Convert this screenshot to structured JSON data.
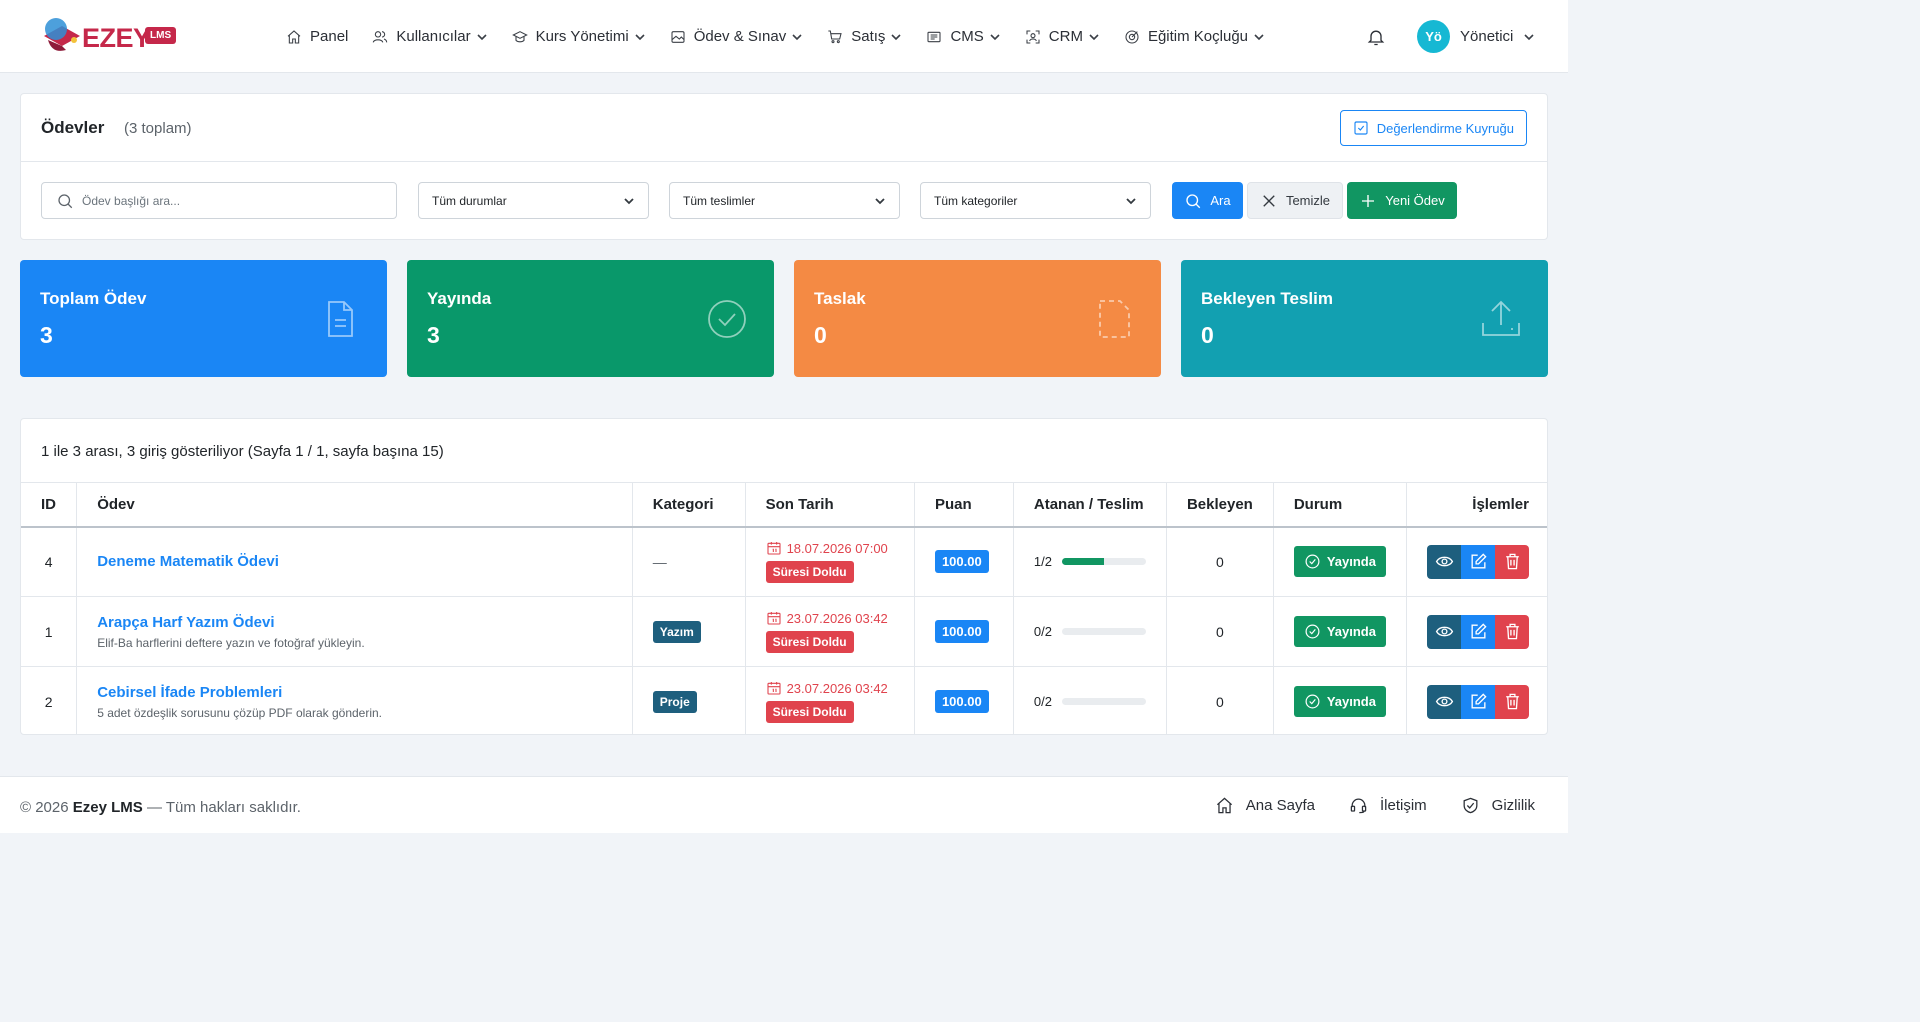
{
  "brand": {
    "name": "EZEY",
    "badge": "LMS",
    "primary_color": "#c5284a"
  },
  "nav": {
    "items": [
      {
        "label": "Panel",
        "icon": "home-icon",
        "has_dropdown": false
      },
      {
        "label": "Kullanıcılar",
        "icon": "users-icon",
        "has_dropdown": true
      },
      {
        "label": "Kurs Yönetimi",
        "icon": "graduation-cap-icon",
        "has_dropdown": true
      },
      {
        "label": "Ödev & Sınav",
        "icon": "image-icon",
        "has_dropdown": true
      },
      {
        "label": "Satış",
        "icon": "cart-icon",
        "has_dropdown": true
      },
      {
        "label": "CMS",
        "icon": "newspaper-icon",
        "has_dropdown": true
      },
      {
        "label": "CRM",
        "icon": "scan-user-icon",
        "has_dropdown": true
      },
      {
        "label": "Eğitim Koçluğu",
        "icon": "target-icon",
        "has_dropdown": true
      }
    ]
  },
  "user": {
    "initials": "Yö",
    "name": "Yönetici"
  },
  "page": {
    "title": "Ödevler",
    "count": "(3 toplam)",
    "queue_button": "Değerlendirme Kuyruğu"
  },
  "filters": {
    "search_placeholder": "Ödev başlığı ara...",
    "status": "Tüm durumlar",
    "submissions": "Tüm teslimler",
    "categories": "Tüm kategoriler",
    "search_button": "Ara",
    "clear_button": "Temizle",
    "new_button": "Yeni Ödev"
  },
  "stats": [
    {
      "label": "Toplam Ödev",
      "value": "3",
      "color": "#1a86f5",
      "icon": "document-icon"
    },
    {
      "label": "Yayında",
      "value": "3",
      "color": "#09986a",
      "icon": "check-circle-icon"
    },
    {
      "label": "Taslak",
      "value": "0",
      "color": "#f48a44",
      "icon": "dashed-document-icon"
    },
    {
      "label": "Bekleyen Teslim",
      "value": "0",
      "color": "#12a0b1",
      "icon": "upload-icon"
    }
  ],
  "table": {
    "info": "1 ile 3 arası, 3 giriş gösteriliyor (Sayfa 1 / 1, sayfa başına 15)",
    "headers": {
      "id": "ID",
      "title": "Ödev",
      "category": "Kategori",
      "deadline": "Son Tarih",
      "score": "Puan",
      "assigned": "Atanan / Teslim",
      "waiting": "Bekleyen",
      "status": "Durum",
      "actions": "İşlemler"
    },
    "rows": [
      {
        "id": "4",
        "title": "Deneme Matematik Ödevi",
        "desc": "",
        "category": "—",
        "deadline": "18.07.2026 07:00",
        "expired": "Süresi Doldu",
        "score": "100.00",
        "assigned": "1/2",
        "progress": 0.5,
        "waiting": "0",
        "status": "Yayında"
      },
      {
        "id": "1",
        "title": "Arapça Harf Yazım Ödevi",
        "desc": "Elif-Ba harflerini deftere yazın ve fotoğraf yükleyin.",
        "category": "Yazım",
        "deadline": "23.07.2026 03:42",
        "expired": "Süresi Doldu",
        "score": "100.00",
        "assigned": "0/2",
        "progress": 0,
        "waiting": "0",
        "status": "Yayında"
      },
      {
        "id": "2",
        "title": "Cebirsel İfade Problemleri",
        "desc": "5 adet özdeşlik sorusunu çözüp PDF olarak gönderin.",
        "category": "Proje",
        "deadline": "23.07.2026 03:42",
        "expired": "Süresi Doldu",
        "score": "100.00",
        "assigned": "0/2",
        "progress": 0,
        "waiting": "0",
        "status": "Yayında"
      }
    ]
  },
  "footer": {
    "copyright_prefix": "© 2026",
    "brand": "Ezey LMS",
    "copyright_suffix": "— Tüm hakları saklıdır.",
    "links": [
      {
        "label": "Ana Sayfa",
        "icon": "home-icon"
      },
      {
        "label": "İletişim",
        "icon": "headset-icon"
      },
      {
        "label": "Gizlilik",
        "icon": "shield-check-icon"
      }
    ]
  }
}
